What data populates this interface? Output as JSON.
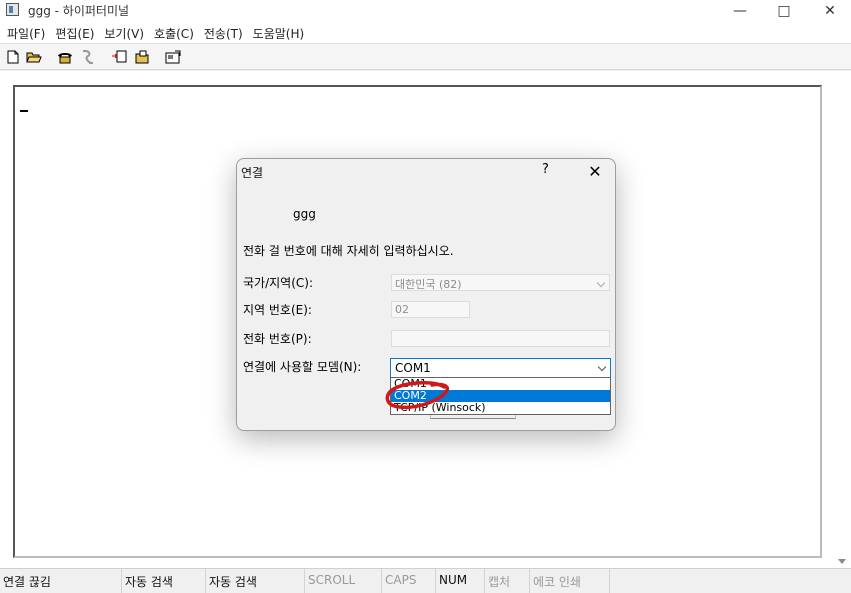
{
  "window": {
    "title": "ggg - 하이퍼터미널"
  },
  "menu": {
    "items": [
      "파일(F)",
      "편집(E)",
      "보기(V)",
      "호출(C)",
      "전송(T)",
      "도움말(H)"
    ]
  },
  "toolbar": {
    "icons": [
      "new-icon",
      "open-icon",
      "dial-icon",
      "disconnect-icon",
      "send-icon",
      "receive-icon",
      "properties-icon"
    ]
  },
  "dialog": {
    "title": "연결",
    "help": "?",
    "connection_name": "ggg",
    "instruction": "전화 걸 번호에 대해 자세히 입력하십시오.",
    "country_label": "국가/지역(C):",
    "country_value": "대한민국 (82)",
    "area_label": "지역 번호(E):",
    "area_value": "02",
    "phone_label": "전화 번호(P):",
    "phone_value": "",
    "modem_label": "연결에 사용할 모뎀(N):",
    "modem_value": "COM1",
    "modem_options": [
      "COM1",
      "COM2",
      "TCP/IP (Winsock)"
    ],
    "modem_selected_index": 1
  },
  "status": {
    "connection": "연결 끊김",
    "detect1": "자동 검색",
    "detect2": "자동 검색",
    "scroll": "SCROLL",
    "caps": "CAPS",
    "num": "NUM",
    "capture": "캡처",
    "echo": "에코 인쇄"
  },
  "colors": {
    "accent": "#0078d7",
    "annotation": "#d01818"
  }
}
